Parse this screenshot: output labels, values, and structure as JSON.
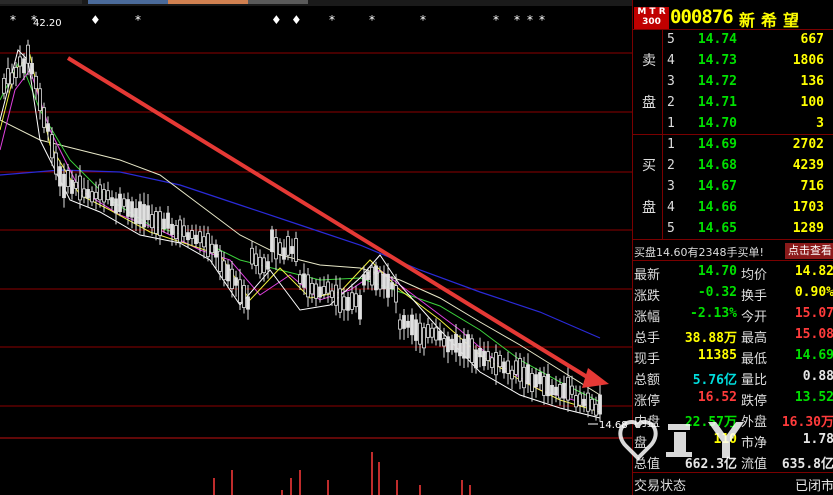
{
  "chart": {
    "high_label": "42.20",
    "last_price_tag": "14.68",
    "marker_glyph": "*",
    "marker_glyph_small": "♦",
    "colors": {
      "trend_arrow": "#e53935",
      "ma_long": "#2a2ad8",
      "ma_mid": "#e8e8c8",
      "ma_green": "#3cd23c",
      "ma_magenta": "#e040e0",
      "ma_yellow": "#f0f040",
      "ma_white": "#ffffff",
      "candle": "#e0e0e0",
      "grid": "#8b0000"
    }
  },
  "quote": {
    "badge": "M T R\n300",
    "code": "000876",
    "name": "新希望"
  },
  "orderbook": {
    "sell_side_label": [
      "卖",
      "盘"
    ],
    "buy_side_label": [
      "买",
      "盘"
    ],
    "sells": [
      {
        "level": "5",
        "price": "14.74",
        "volume": "667"
      },
      {
        "level": "4",
        "price": "14.73",
        "volume": "1806"
      },
      {
        "level": "3",
        "price": "14.72",
        "volume": "136"
      },
      {
        "level": "2",
        "price": "14.71",
        "volume": "100"
      },
      {
        "level": "1",
        "price": "14.70",
        "volume": "3"
      }
    ],
    "buys": [
      {
        "level": "1",
        "price": "14.69",
        "volume": "2702"
      },
      {
        "level": "2",
        "price": "14.68",
        "volume": "4239"
      },
      {
        "level": "3",
        "price": "14.67",
        "volume": "716"
      },
      {
        "level": "4",
        "price": "14.66",
        "volume": "1703"
      },
      {
        "level": "5",
        "price": "14.65",
        "volume": "1289"
      }
    ]
  },
  "notice": {
    "text": "买盘14.60有2348手买单!",
    "button": "点击查看"
  },
  "stats": [
    {
      "l1": "最新",
      "v1": "14.70",
      "c1": "g",
      "l2": "均价",
      "v2": "14.82",
      "c2": "y"
    },
    {
      "l1": "涨跌",
      "v1": "-0.32",
      "c1": "g",
      "l2": "换手",
      "v2": "0.90%",
      "c2": "y"
    },
    {
      "l1": "涨幅",
      "v1": "-2.13%",
      "c1": "g",
      "l2": "今开",
      "v2": "15.07",
      "c2": "r"
    },
    {
      "l1": "总手",
      "v1": "38.88万",
      "c1": "y",
      "l2": "最高",
      "v2": "15.08",
      "c2": "r"
    },
    {
      "l1": "现手",
      "v1": "11385",
      "c1": "y",
      "l2": "最低",
      "v2": "14.69",
      "c2": "g"
    },
    {
      "l1": "总额",
      "v1": "5.76亿",
      "c1": "c",
      "l2": "量比",
      "v2": "0.88",
      "c2": "w"
    },
    {
      "l1": "涨停",
      "v1": "16.52",
      "c1": "r",
      "l2": "跌停",
      "v2": "13.52",
      "c2": "g"
    },
    {
      "l1": "内盘",
      "v1": "22.57万",
      "c1": "g",
      "l2": "外盘",
      "v2": "16.30万",
      "c2": "r"
    },
    {
      "l1": "盘",
      "v1": "110",
      "c1": "y",
      "l2": "市净",
      "v2": "1.78",
      "c2": "w"
    },
    {
      "l1": "总值",
      "v1": "662.3亿",
      "c1": "w",
      "l2": "流值",
      "v2": "635.8亿",
      "c2": "w"
    }
  ],
  "trade_status": {
    "label": "交易状态",
    "value": "已闭市"
  }
}
